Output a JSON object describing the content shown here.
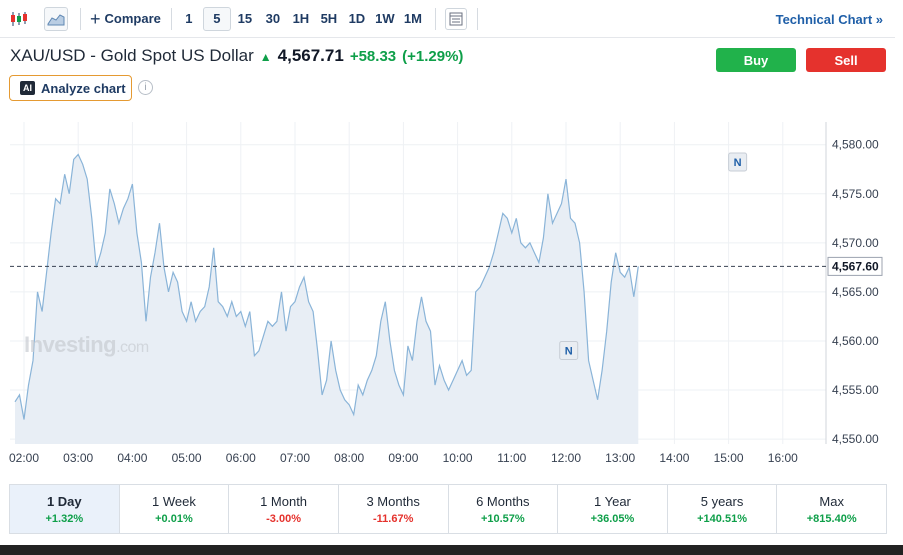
{
  "toolbar": {
    "compare_label": "Compare",
    "intervals": [
      "1",
      "5",
      "15",
      "30",
      "1H",
      "5H",
      "1D",
      "1W",
      "1M"
    ],
    "active_interval": "5",
    "technical_chart_label": "Technical Chart »"
  },
  "header": {
    "symbol_title": "XAU/USD - Gold Spot US Dollar",
    "price": "4,567.71",
    "change": "+58.33",
    "change_pct": "(+1.29%)",
    "buy_label": "Buy",
    "sell_label": "Sell",
    "analyze_label": "Analyze chart",
    "ai_badge": "AI"
  },
  "watermark": {
    "main": "Investing",
    "suffix": ".com"
  },
  "colors": {
    "up": "#0e9f49",
    "down": "#e5322d",
    "line": "#8ab4d8",
    "area": "#e8eef5",
    "buy": "#21b24b",
    "sell": "#e5322d"
  },
  "chart_data": {
    "type": "area",
    "x_ticks": [
      "02:00",
      "03:00",
      "04:00",
      "05:00",
      "06:00",
      "07:00",
      "08:00",
      "09:00",
      "10:00",
      "11:00",
      "12:00",
      "13:00",
      "14:00",
      "15:00",
      "16:00"
    ],
    "y_ticks": [
      "4,580.00",
      "4,575.00",
      "4,570.00",
      "4,565.00",
      "4,560.00",
      "4,555.00",
      "4,550.00"
    ],
    "ylim": [
      4549.5,
      4581.5
    ],
    "current_price_label": "4,567.60",
    "current_price": 4567.6,
    "news_markers": [
      {
        "label": "N",
        "time": "12:03",
        "value": 4557.2
      },
      {
        "label": "N",
        "time": "15:10",
        "value": 4576.4
      }
    ],
    "x_start": "01:50",
    "minutes_per_point": 5,
    "values": [
      4553.8,
      4554.5,
      4552.0,
      4555.5,
      4558.0,
      4565.0,
      4563.0,
      4567.0,
      4571.0,
      4574.5,
      4574.0,
      4577.0,
      4575.0,
      4578.5,
      4579.0,
      4578.0,
      4576.5,
      4572.5,
      4567.5,
      4569.0,
      4571.0,
      4575.5,
      4574.0,
      4572.0,
      4573.5,
      4574.5,
      4576.0,
      4571.0,
      4568.0,
      4562.0,
      4566.5,
      4569.0,
      4572.0,
      4567.5,
      4565.0,
      4567.0,
      4566.0,
      4563.0,
      4562.0,
      4564.0,
      4562.0,
      4563.0,
      4563.5,
      4565.5,
      4569.5,
      4564.0,
      4563.5,
      4562.5,
      4564.0,
      4562.5,
      4563.0,
      4561.5,
      4563.0,
      4558.5,
      4559.0,
      4560.5,
      4562.0,
      4561.5,
      4562.0,
      4565.0,
      4561.0,
      4563.5,
      4564.0,
      4565.5,
      4566.5,
      4564.0,
      4563.0,
      4559.0,
      4554.5,
      4556.0,
      4560.0,
      4557.0,
      4555.0,
      4554.0,
      4553.5,
      4552.5,
      4555.5,
      4554.5,
      4556.0,
      4557.0,
      4558.5,
      4562.0,
      4564.0,
      4560.0,
      4557.0,
      4555.5,
      4554.5,
      4559.5,
      4558.0,
      4562.0,
      4564.5,
      4562.0,
      4561.0,
      4555.5,
      4557.5,
      4556.0,
      4555.0,
      4556.0,
      4557.0,
      4558.0,
      4556.5,
      4557.0,
      4565.0,
      4565.5,
      4566.5,
      4567.5,
      4569.0,
      4571.0,
      4573.0,
      4572.5,
      4571.0,
      4572.5,
      4570.0,
      4569.5,
      4570.0,
      4569.0,
      4568.0,
      4570.5,
      4575.0,
      4572.0,
      4573.0,
      4574.0,
      4576.5,
      4572.5,
      4572.0,
      4570.0,
      4565.0,
      4558.0,
      4556.0,
      4554.0,
      4557.0,
      4561.0,
      4566.0,
      4569.0,
      4567.0,
      4566.5,
      4567.5,
      4564.5,
      4567.6
    ]
  },
  "periods": [
    {
      "label": "1 Day",
      "value": "+1.32%",
      "dir": "pos",
      "active": true
    },
    {
      "label": "1 Week",
      "value": "+0.01%",
      "dir": "pos",
      "active": false
    },
    {
      "label": "1 Month",
      "value": "-3.00%",
      "dir": "neg",
      "active": false
    },
    {
      "label": "3 Months",
      "value": "-11.67%",
      "dir": "neg",
      "active": false
    },
    {
      "label": "6 Months",
      "value": "+10.57%",
      "dir": "pos",
      "active": false
    },
    {
      "label": "1 Year",
      "value": "+36.05%",
      "dir": "pos",
      "active": false
    },
    {
      "label": "5 years",
      "value": "+140.51%",
      "dir": "pos",
      "active": false
    },
    {
      "label": "Max",
      "value": "+815.40%",
      "dir": "pos",
      "active": false
    }
  ]
}
